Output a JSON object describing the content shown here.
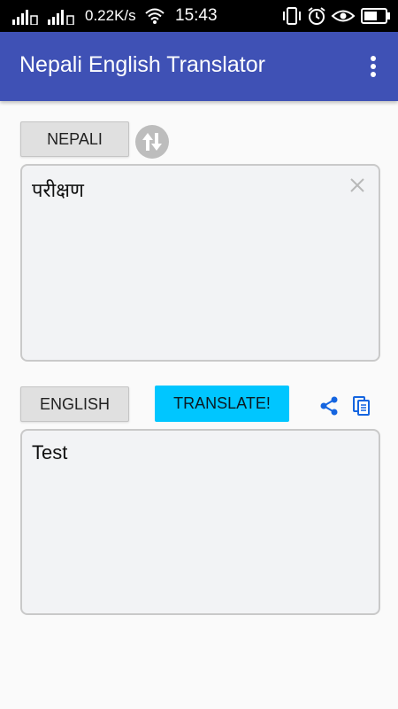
{
  "status_bar": {
    "net_speed": "0.22K/s",
    "time": "15:43",
    "icons": [
      "signal-icon",
      "signal-icon",
      "wifi-icon",
      "vibrate-icon",
      "alarm-icon",
      "eye-icon",
      "battery-icon"
    ]
  },
  "app_bar": {
    "title": "Nepali English Translator",
    "menu_icon": "overflow-menu-icon",
    "color": "#3f51b5"
  },
  "source": {
    "language_label": "NEPALI",
    "text": "परीक्षण",
    "swap_icon": "swap-arrows-icon",
    "clear_icon": "close-icon"
  },
  "target": {
    "language_label": "ENGLISH",
    "text": "Test",
    "translate_label": "TRANSLATE!",
    "share_icon": "share-icon",
    "copy_icon": "copy-icon"
  },
  "colors": {
    "accent": "#00c6ff",
    "action_icons": "#1565e0"
  }
}
